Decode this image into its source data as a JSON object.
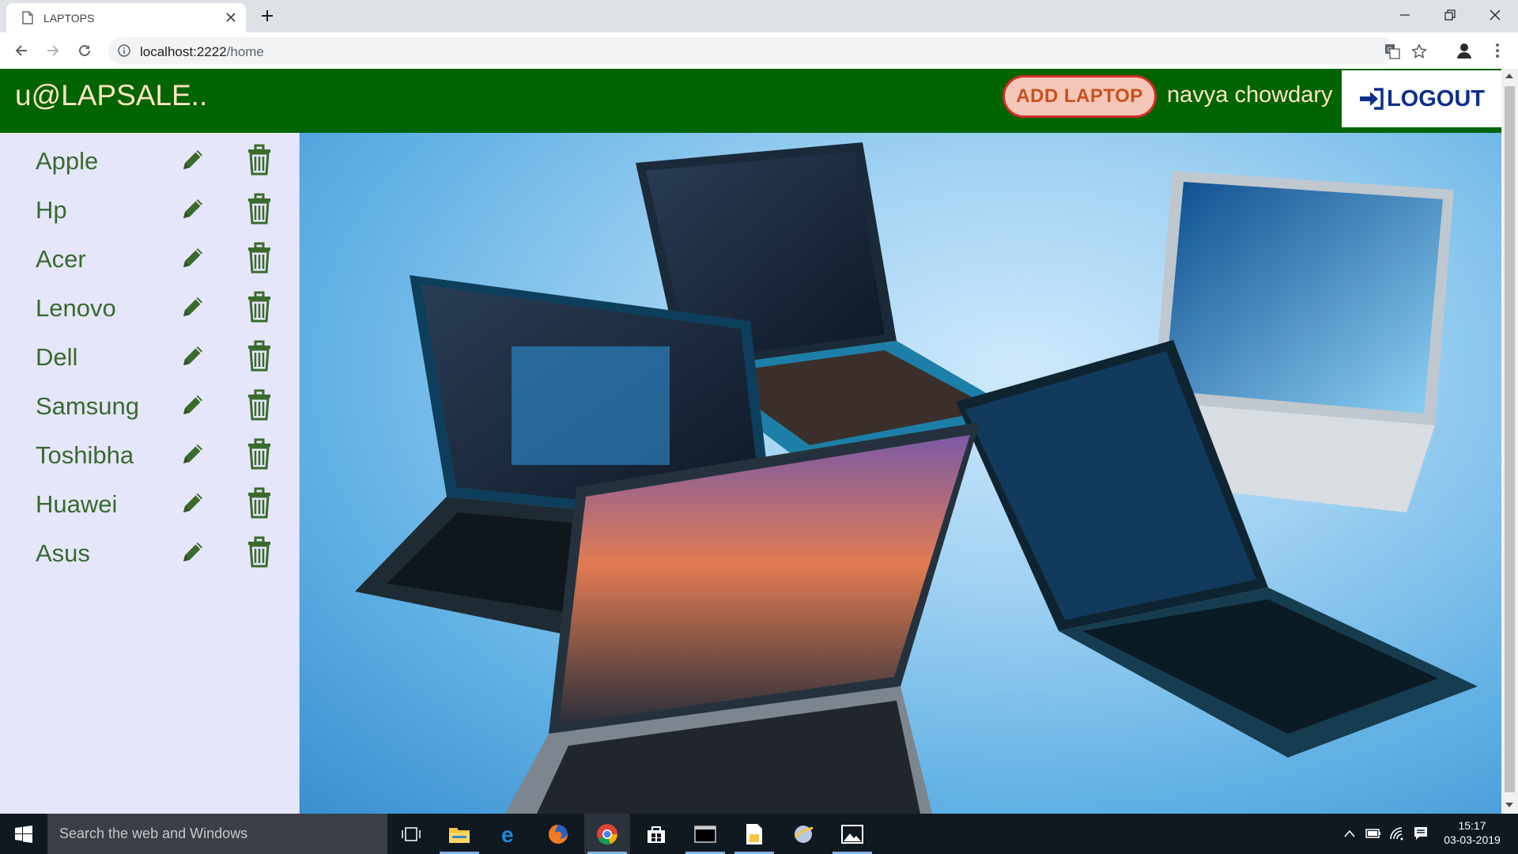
{
  "browser": {
    "tab_title": "LAPTOPS",
    "url_host": "localhost:2222",
    "url_path": "/home"
  },
  "app": {
    "brand": "u@LAPSALE..",
    "add_button": "ADD LAPTOP",
    "username": "navya chowdary",
    "logout_button": "LOGOUT",
    "colors": {
      "navbar": "#006400",
      "sidebar": "#e6e6fa",
      "brand_text": "#ffe4c4",
      "sidebar_text": "#386b2e"
    }
  },
  "sidebar": {
    "brands": [
      {
        "name": "Apple"
      },
      {
        "name": "Hp"
      },
      {
        "name": "Acer"
      },
      {
        "name": "Lenovo"
      },
      {
        "name": "Dell"
      },
      {
        "name": "Samsung"
      },
      {
        "name": "Toshibha"
      },
      {
        "name": "Huawei"
      },
      {
        "name": "Asus"
      }
    ],
    "row_icons": [
      "pencil-icon",
      "trash-icon"
    ]
  },
  "hero": {
    "image_subject": "laptops-collage"
  },
  "taskbar": {
    "search_placeholder": "Search the web and Windows",
    "time": "15:17",
    "date": "03-03-2019"
  }
}
